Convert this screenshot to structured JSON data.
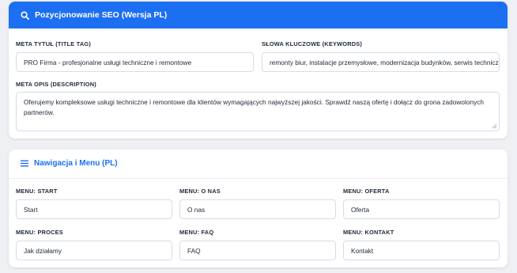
{
  "seo": {
    "title": "Pozycjonowanie SEO (Wersja PL)",
    "icon": "search-icon",
    "header_color": "#1d6ff2",
    "meta_title_label": "META TYTUŁ (TITLE TAG)",
    "meta_title_value": "PRO Firma - profesjonalne usługi techniczne i remontowe",
    "keywords_label": "SŁOWA KLUCZOWE (KEYWORDS)",
    "keywords_value": "remonty biur, instalacje przemysłowe, modernizacja budynków, serwis techniczny",
    "description_label": "META OPIS (DESCRIPTION)",
    "description_value": "Oferujemy kompleksowe usługi techniczne i remontowe dla klientów wymagających najwyższej jakości. Sprawdź naszą ofertę i dołącz do grona zadowolonych partnerów."
  },
  "nav": {
    "title": "Nawigacja i Menu (PL)",
    "icon": "menu-icon",
    "fields": [
      {
        "label": "MENU: START",
        "value": "Start"
      },
      {
        "label": "MENU: O NAS",
        "value": "O nas"
      },
      {
        "label": "MENU: OFERTA",
        "value": "Oferta"
      },
      {
        "label": "MENU: PROCES",
        "value": "Jak działamy"
      },
      {
        "label": "MENU: FAQ",
        "value": "FAQ"
      },
      {
        "label": "MENU: KONTAKT",
        "value": "Kontakt"
      }
    ]
  }
}
